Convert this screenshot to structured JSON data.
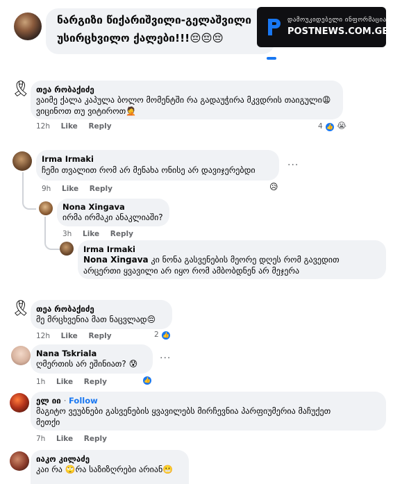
{
  "post": {
    "author": "ნარგიზი წიქარიშვილი-გელაშვილი",
    "text": "უსირცხვილო ქალები!!!😔😔😔"
  },
  "watermark": {
    "small": "დამოუკიდებელი ინფორმაცია",
    "big": "POSTNEWS.COM.GE"
  },
  "comments": [
    {
      "name": "თეა რობაქიძე",
      "lines": [
        "ვაიმე ქალა კაპულა ბოლო მომენტში რა გადაუჭირა მკვდრის თაიგული😩",
        "ვიცინოთ თუ ვიტიროთ🤦"
      ],
      "time": "12h",
      "like": "Like",
      "reply": "Reply",
      "reactions": "4"
    },
    {
      "name": "Irma Irmaki",
      "lines": [
        "ჩემი თვალით რომ არ მენახა ონისე არ დავიჯერებდი"
      ],
      "time": "9h",
      "like": "Like",
      "reply": "Reply",
      "more": "···"
    },
    {
      "name": "Nona Xingava",
      "lines": [
        "ირმა ირმაკი ანაკლიაში?"
      ],
      "time": "3h",
      "like": "Like",
      "reply": "Reply"
    },
    {
      "name": "Irma Irmaki",
      "mention": "Nona Xingava",
      "lines": [
        "კი ნონა გასვენების მეორე დღეს რომ გავედით",
        "არცერთი ყვავილი არ იყო რომ ამბობდნენ არ მეჯერა"
      ]
    },
    {
      "name": "თეა რობაქიძე",
      "lines": [
        "მე მრცხვენია მათ ნაცვლად😔"
      ],
      "time": "12h",
      "like": "Like",
      "reply": "Reply",
      "reactions": "2"
    },
    {
      "name": "Nana Tskriala",
      "lines": [
        "ღმერთის არ ეშინიათ? 😰"
      ],
      "time": "1h",
      "like": "Like",
      "reply": "Reply",
      "more": "···"
    },
    {
      "name": "ელ იი",
      "follow": "Follow",
      "lines": [
        "მაგიტო ვეუბნები გასვენების ყვავილებს მირჩევნია პარფიუმერია მაჩუქეთ",
        "მეთქი"
      ],
      "time": "7h",
      "like": "Like",
      "reply": "Reply"
    },
    {
      "name": "იაკო კილაძე",
      "lines": [
        "კაი რა 🙄რა საზიზღრები არიან😬"
      ]
    }
  ],
  "colors": {
    "accent": "#1877f2",
    "bubble": "#f0f2f5",
    "meta": "#65676b"
  }
}
